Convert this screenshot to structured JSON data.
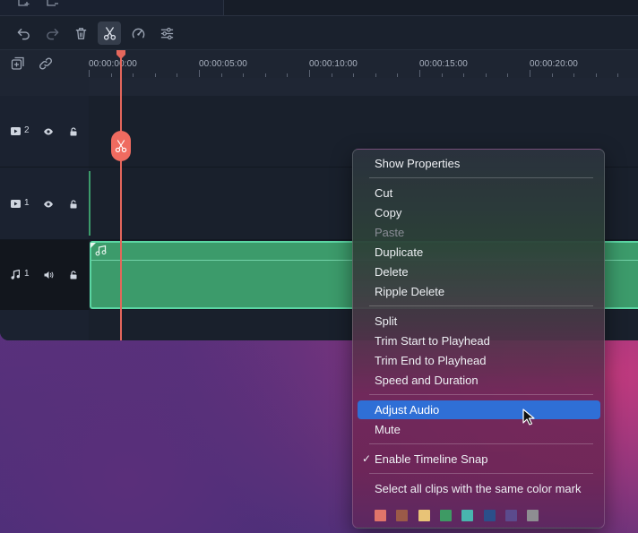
{
  "ruler": {
    "labels": [
      "00:00:00:00",
      "00:00:05:00",
      "00:00:10:00",
      "00:00:15:00",
      "00:00:20:00"
    ]
  },
  "tracks": [
    {
      "type": "video",
      "number": "2"
    },
    {
      "type": "video",
      "number": "1"
    },
    {
      "type": "audio",
      "number": "1"
    }
  ],
  "toolbar": {
    "icons": [
      "undo-icon",
      "redo-icon",
      "trash-icon",
      "scissors-icon",
      "speed-icon",
      "adjust-icon"
    ]
  },
  "context_menu": {
    "show_properties": "Show Properties",
    "cut": "Cut",
    "copy": "Copy",
    "paste": "Paste",
    "duplicate": "Duplicate",
    "delete": "Delete",
    "ripple_delete": "Ripple Delete",
    "split": "Split",
    "trim_start": "Trim Start to Playhead",
    "trim_end": "Trim End to Playhead",
    "speed_duration": "Speed and Duration",
    "adjust_audio": "Adjust Audio",
    "mute": "Mute",
    "enable_snap": "Enable Timeline Snap",
    "select_same_color": "Select all clips with the same color mark",
    "color_marks": [
      "#e0756a",
      "#9b5a48",
      "#e8c377",
      "#3e9a64",
      "#48b5ae",
      "#2b4f8a",
      "#5b4b8d",
      "#8e8e92"
    ]
  },
  "colors": {
    "accent_highlight": "#2f6fd6",
    "playhead": "#e4675c",
    "audio_clip": "#3c9b6b"
  }
}
